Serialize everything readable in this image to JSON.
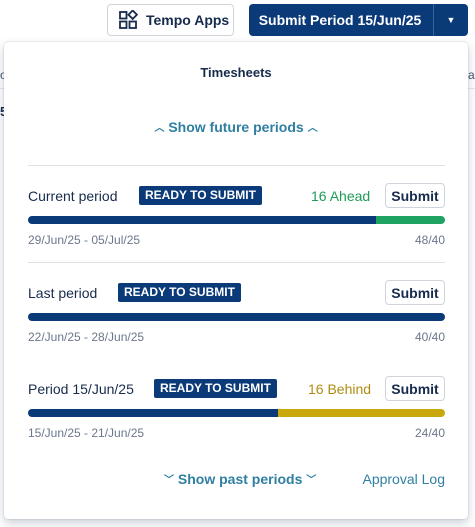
{
  "header": {
    "apps_button_label": "Tempo Apps",
    "submit_button_label": "Submit Period 15/Jun/25"
  },
  "popup": {
    "title": "Timesheets",
    "show_future_label": "Show future periods",
    "show_past_label": "Show past periods",
    "approval_log_label": "Approval Log",
    "periods": [
      {
        "label": "Current period",
        "badge": "READY TO SUBMIT",
        "status": "16 Ahead",
        "status_type": "ahead",
        "submit_label": "Submit",
        "date_range": "29/Jun/25 - 05/Jul/25",
        "hours": "48/40",
        "logged": 48,
        "required": 40
      },
      {
        "label": "Last period",
        "badge": "READY TO SUBMIT",
        "status": "",
        "status_type": "none",
        "submit_label": "Submit",
        "date_range": "22/Jun/25 - 28/Jun/25",
        "hours": "40/40",
        "logged": 40,
        "required": 40
      },
      {
        "label": "Period 15/Jun/25",
        "badge": "READY TO SUBMIT",
        "status": "16 Behind",
        "status_type": "behind",
        "submit_label": "Submit",
        "date_range": "15/Jun/25 - 21/Jun/25",
        "hours": "24/40",
        "logged": 24,
        "required": 40
      }
    ]
  },
  "colors": {
    "primary": "#0b3a78",
    "ahead": "#1ea362",
    "behind": "#c9a80e",
    "link": "#2f7fa3"
  }
}
